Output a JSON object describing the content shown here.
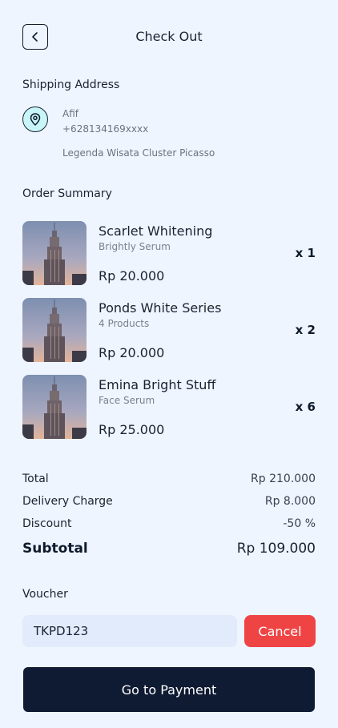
{
  "header": {
    "title": "Check Out",
    "back_icon": "chevron-left-icon"
  },
  "shipping": {
    "section_title": "Shipping Address",
    "icon": "map-pin-icon",
    "name": "Afif",
    "phone": "+628134169xxxx",
    "address": "Legenda Wisata Cluster Picasso"
  },
  "order": {
    "section_title": "Order Summary",
    "items": [
      {
        "name": "Scarlet Whitening",
        "subtitle": "Brightly Serum",
        "price": "Rp 20.000",
        "qty": "x 1",
        "image": "building-photo"
      },
      {
        "name": "Ponds White Series",
        "subtitle": "4 Products",
        "price": "Rp 20.000",
        "qty": "x 2",
        "image": "building-photo"
      },
      {
        "name": "Emina Bright Stuff",
        "subtitle": "Face Serum",
        "price": "Rp 25.000",
        "qty": "x 6",
        "image": "building-photo"
      }
    ]
  },
  "summary": {
    "total_label": "Total",
    "total_value": "Rp 210.000",
    "delivery_label": "Delivery Charge",
    "delivery_value": "Rp 8.000",
    "discount_label": "Discount",
    "discount_value": "-50 %",
    "subtotal_label": "Subtotal",
    "subtotal_value": "Rp 109.000"
  },
  "voucher": {
    "section_title": "Voucher",
    "code": "TKPD123",
    "cancel_label": "Cancel"
  },
  "payment": {
    "button_label": "Go to Payment"
  },
  "colors": {
    "background": "#eef5ff",
    "primary_dark": "#0f1b33",
    "danger": "#ef4444",
    "input_bg": "#e2ebfb",
    "pin_bg": "#c8f5f8"
  }
}
